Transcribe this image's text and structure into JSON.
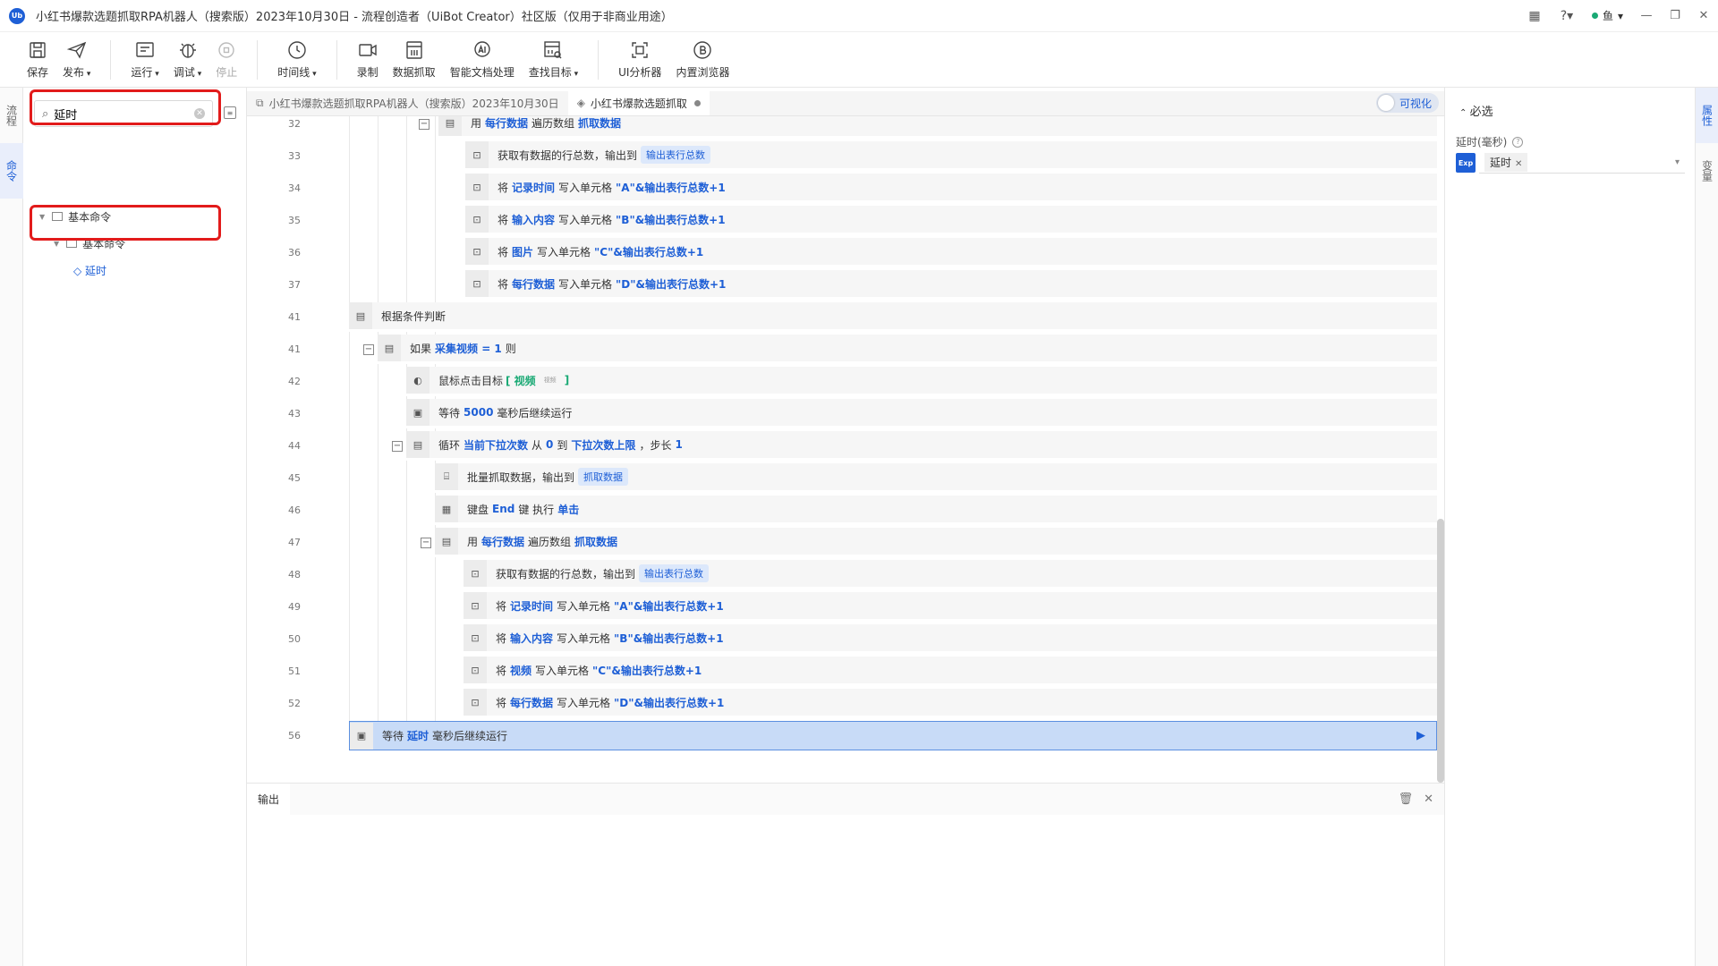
{
  "window": {
    "title": "小红书爆款选题抓取RPA机器人（搜索版）2023年10月30日 - 流程创造者（UiBot Creator）社区版（仅用于非商业用途）",
    "logo_text": "Ub",
    "user_name": "鱼"
  },
  "toolbar": {
    "save": "保存",
    "publish": "发布",
    "run": "运行",
    "debug": "调试",
    "stop": "停止",
    "timeline": "时间线",
    "record": "录制",
    "data_scrape": "数据抓取",
    "smart_doc": "智能文档处理",
    "find_target": "查找目标",
    "ui_analyzer": "UI分析器",
    "builtin_browser": "内置浏览器"
  },
  "left_rail": {
    "flow": "流程",
    "command": "命令"
  },
  "command_panel": {
    "search_value": "延时",
    "tree": [
      {
        "label": "基本命令"
      },
      {
        "label": "基本命令"
      },
      {
        "label": "◇ 延时"
      }
    ]
  },
  "tabs": [
    {
      "label": "小红书爆款选题抓取RPA机器人（搜索版）2023年10月30日"
    },
    {
      "label": "小红书爆款选题抓取"
    }
  ],
  "viz_toggle": "可视化",
  "code_rows": [
    {
      "num": "32",
      "parts": [
        "用",
        "每行数据",
        "遍历数组",
        "抓取数据"
      ]
    },
    {
      "num": "33",
      "parts": [
        "获取有数据的行总数，输出到",
        "输出表行总数"
      ]
    },
    {
      "num": "34",
      "parts": [
        "将",
        "记录时间",
        "写入单元格",
        "\"A\"&输出表行总数+1"
      ]
    },
    {
      "num": "35",
      "parts": [
        "将",
        "输入内容",
        "写入单元格",
        "\"B\"&输出表行总数+1"
      ]
    },
    {
      "num": "36",
      "parts": [
        "将",
        "图片",
        "写入单元格",
        "\"C\"&输出表行总数+1"
      ]
    },
    {
      "num": "37",
      "parts": [
        "将",
        "每行数据",
        "写入单元格",
        "\"D\"&输出表行总数+1"
      ]
    },
    {
      "num": "41",
      "parts": [
        "根据条件判断"
      ]
    },
    {
      "num": "41",
      "parts": [
        "如果",
        "采集视频 = 1",
        "则"
      ]
    },
    {
      "num": "42",
      "parts": [
        "鼠标点击目标",
        "[ 视频",
        "视频",
        "]"
      ]
    },
    {
      "num": "43",
      "parts": [
        "等待",
        "5000",
        "毫秒后继续运行"
      ]
    },
    {
      "num": "44",
      "parts": [
        "循环",
        "当前下拉次数",
        "从",
        "0",
        "到",
        "下拉次数上限",
        "，步长",
        "1"
      ]
    },
    {
      "num": "45",
      "parts": [
        "批量抓取数据，输出到",
        "抓取数据"
      ]
    },
    {
      "num": "46",
      "parts": [
        "键盘",
        "End",
        "键 执行",
        "单击"
      ]
    },
    {
      "num": "47",
      "parts": [
        "用",
        "每行数据",
        "遍历数组",
        "抓取数据"
      ]
    },
    {
      "num": "48",
      "parts": [
        "获取有数据的行总数，输出到",
        "输出表行总数"
      ]
    },
    {
      "num": "49",
      "parts": [
        "将",
        "记录时间",
        "写入单元格",
        "\"A\"&输出表行总数+1"
      ]
    },
    {
      "num": "50",
      "parts": [
        "将",
        "输入内容",
        "写入单元格",
        "\"B\"&输出表行总数+1"
      ]
    },
    {
      "num": "51",
      "parts": [
        "将",
        "视频",
        "写入单元格",
        "\"C\"&输出表行总数+1"
      ]
    },
    {
      "num": "52",
      "parts": [
        "将",
        "每行数据",
        "写入单元格",
        "\"D\"&输出表行总数+1"
      ]
    },
    {
      "num": "56",
      "parts": [
        "等待",
        "延时",
        "毫秒后继续运行"
      ]
    }
  ],
  "output": {
    "tab": "输出"
  },
  "props": {
    "section": "必选",
    "field_label": "延时(毫秒)",
    "exp_badge": "Exp",
    "value": "延时"
  },
  "right_rail": {
    "attr": "属性",
    "var": "变量"
  },
  "colors": {
    "accent": "#1e5fd6",
    "highlight_red": "#e21b1b",
    "selected_row": "#c8dbf7"
  }
}
